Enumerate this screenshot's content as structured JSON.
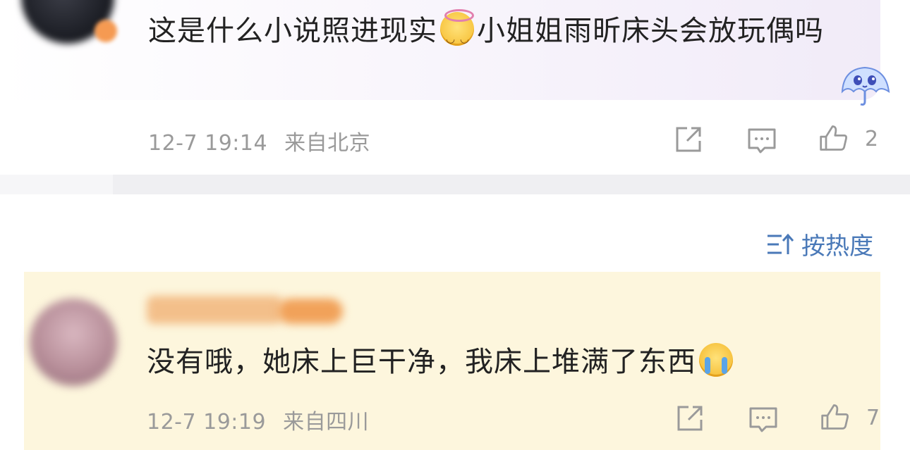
{
  "comments": [
    {
      "text_part1": "这是什么小说照进现实",
      "emoji1": "angel-smile-emoji",
      "text_part2": "小姐姐雨昕床头会放玩偶吗",
      "time": "12-7 19:14",
      "location": "来自北京",
      "likes": "2",
      "mascot": "umbrella-mascot-sticker"
    },
    {
      "text_part1": "没有哦，她床上巨干净，我床上堆满了东西",
      "emoji1": "crying-emoji",
      "time": "12-7 19:19",
      "location": "来自四川",
      "likes": "7"
    }
  ],
  "sort": {
    "label": "按热度",
    "icon": "sort-icon"
  },
  "colors": {
    "sort_accent": "#4a79b8",
    "reply_highlight": "#fdf6dd",
    "meta_gray": "#9a9a9a"
  }
}
